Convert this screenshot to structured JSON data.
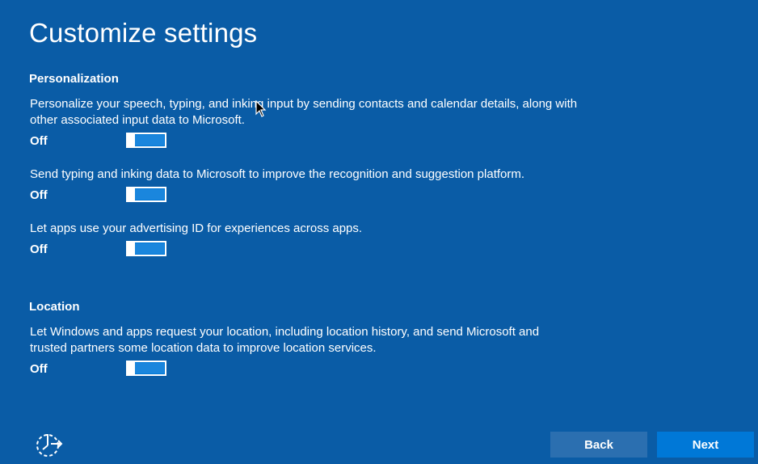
{
  "page": {
    "title": "Customize settings"
  },
  "personalization": {
    "heading": "Personalization",
    "settings": [
      {
        "description": "Personalize your speech, typing, and inking input by sending contacts and calendar details, along with other associated input data to Microsoft.",
        "state": "Off"
      },
      {
        "description": "Send typing and inking data to Microsoft to improve the recognition and suggestion platform.",
        "state": "Off"
      },
      {
        "description": "Let apps use your advertising ID for experiences across apps.",
        "state": "Off"
      }
    ]
  },
  "location": {
    "heading": "Location",
    "settings": [
      {
        "description": "Let Windows and apps request your location, including location history, and send Microsoft and trusted partners some location data to improve location services.",
        "state": "Off"
      }
    ]
  },
  "footer": {
    "ease_of_access_icon": "ease-of-access-icon",
    "back_label": "Back",
    "next_label": "Next"
  },
  "colors": {
    "background": "#0a5ca6",
    "accent": "#0078d7",
    "back_button": "#2b6fb0",
    "text": "#ffffff"
  }
}
